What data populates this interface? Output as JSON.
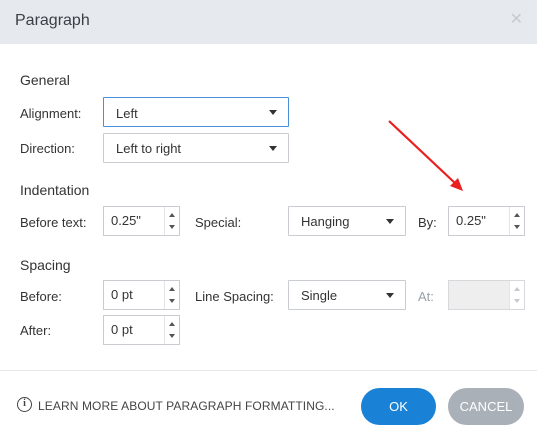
{
  "dialog": {
    "title": "Paragraph",
    "close_icon": "close-icon"
  },
  "general": {
    "heading": "General",
    "alignment_label": "Alignment:",
    "alignment_value": "Left",
    "direction_label": "Direction:",
    "direction_value": "Left to right"
  },
  "indentation": {
    "heading": "Indentation",
    "before_text_label": "Before text:",
    "before_text_value": "0.25\"",
    "special_label": "Special:",
    "special_value": "Hanging",
    "by_label": "By:",
    "by_value": "0.25\""
  },
  "spacing": {
    "heading": "Spacing",
    "before_label": "Before:",
    "before_value": "0 pt",
    "line_spacing_label": "Line Spacing:",
    "line_spacing_value": "Single",
    "at_label": "At:",
    "at_value": "",
    "after_label": "After:",
    "after_value": "0 pt"
  },
  "footer": {
    "learn_more": "LEARN MORE ABOUT PARAGRAPH FORMATTING...",
    "ok_label": "OK",
    "cancel_label": "CANCEL"
  },
  "colors": {
    "primary": "#1a82d6",
    "cancel": "#aab0b8",
    "annotation_arrow": "#e8201f"
  }
}
